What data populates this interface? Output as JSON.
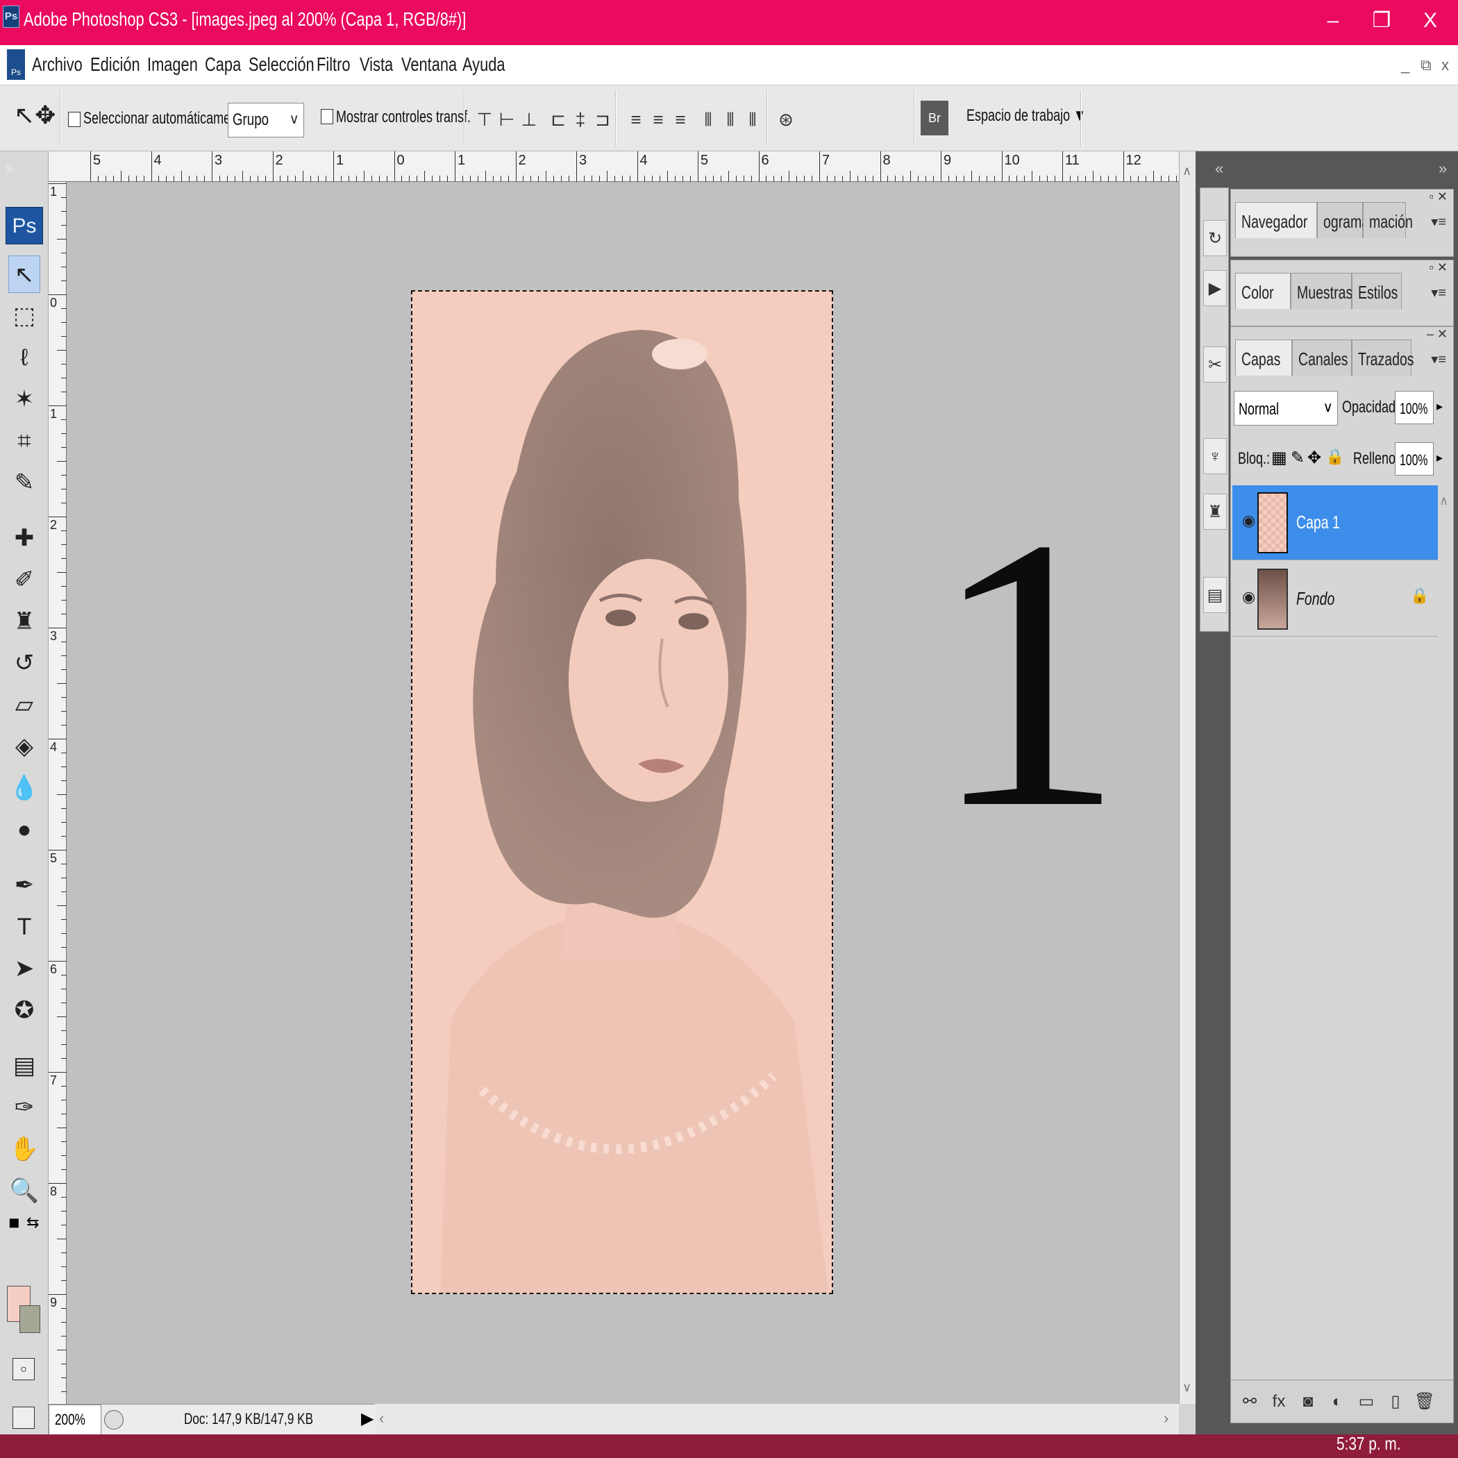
{
  "window": {
    "title": "Adobe Photoshop CS3 - [images.jpeg al 200% (Capa 1, RGB/8#)]",
    "minimize": "–",
    "restore": "❐",
    "close": "X"
  },
  "menu": {
    "items": [
      "Archivo",
      "Edición",
      "Imagen",
      "Capa",
      "Selección",
      "Filtro",
      "Vista",
      "Ventana",
      "Ayuda"
    ],
    "doc_controls": [
      "_",
      "⧉",
      "x"
    ]
  },
  "options": {
    "auto_select_label": "Seleccionar automáticamente:",
    "auto_select_value": "Grupo",
    "transform_label": "Mostrar controles transf.",
    "workspace_label": "Espacio de trabajo ▼"
  },
  "ruler": {
    "h_labels": [
      "5",
      "4",
      "3",
      "2",
      "1",
      "0",
      "1",
      "2",
      "3",
      "4",
      "5",
      "6",
      "7",
      "8",
      "9",
      "10",
      "11",
      "12"
    ],
    "v_labels": [
      "1",
      "0",
      "1",
      "2",
      "3",
      "4",
      "5",
      "6",
      "7",
      "8",
      "9"
    ]
  },
  "toolbox": {
    "badge": "Ps",
    "tools": [
      "move-tool-icon",
      "marquee-tool-icon",
      "lasso-tool-icon",
      "magic-wand-icon",
      "crop-tool-icon",
      "slice-tool-icon",
      "healing-brush-icon",
      "brush-tool-icon",
      "clone-stamp-icon",
      "history-brush-icon",
      "eraser-icon",
      "paint-bucket-icon",
      "blur-tool-icon",
      "dodge-tool-icon",
      "pen-tool-icon",
      "type-tool-icon",
      "path-selection-icon",
      "shape-tool-icon",
      "notes-tool-icon",
      "eyedropper-icon",
      "hand-tool-icon",
      "zoom-tool-icon"
    ],
    "foreground_color": "#f6cdc2",
    "background_color": "#a5a895"
  },
  "canvas": {
    "overlay_number": "1",
    "doc_color": "#f5cdbf"
  },
  "status": {
    "zoom": "200%",
    "doc_info": "Doc: 147,9 KB/147,9 KB"
  },
  "panels": {
    "group1_tabs": [
      "Navegador",
      "ograma",
      "mación"
    ],
    "group2_tabs": [
      "Color",
      "Muestras",
      "Estilos"
    ],
    "group3_tabs": [
      "Capas",
      "Canales",
      "Trazados"
    ]
  },
  "layers": {
    "blend_mode": "Normal",
    "opacity_label": "Opacidad:",
    "opacity_value": "100%",
    "lock_label": "Bloq.:",
    "fill_label": "Relleno:",
    "fill_value": "100%",
    "rows": [
      {
        "name": "Capa 1",
        "selected": true
      },
      {
        "name": "Fondo",
        "selected": false
      }
    ]
  },
  "taskbar": {
    "clock": "5:37 p. m."
  },
  "colors": {
    "titlebar": "#ea0a5e",
    "selection": "#3d8eea"
  }
}
